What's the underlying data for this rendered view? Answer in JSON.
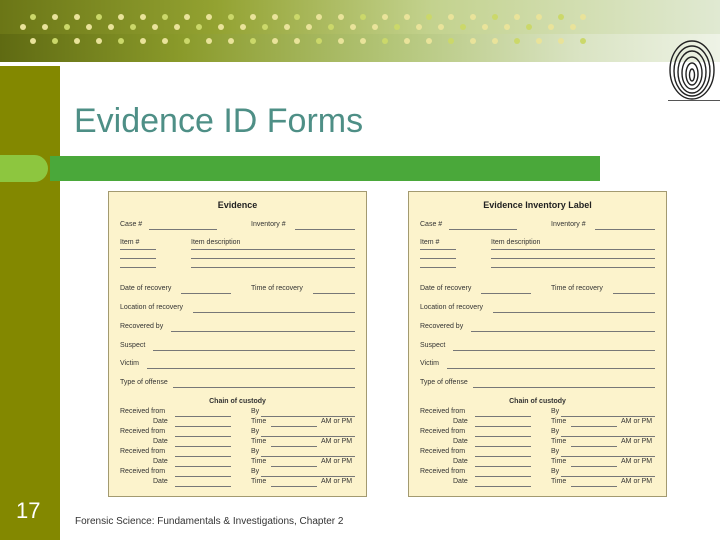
{
  "slide": {
    "title": "Evidence ID Forms",
    "page_number": "17",
    "footer": "Forensic Science: Fundamentals & Investigations, Chapter 2"
  },
  "forms": [
    {
      "title": "Evidence",
      "case_label": "Case #",
      "inventory_label": "Inventory #",
      "item_label": "Item #",
      "item_desc_label": "Item description",
      "date_recovery_label": "Date of recovery",
      "time_recovery_label": "Time of recovery",
      "location_label": "Location of recovery",
      "recovered_by_label": "Recovered by",
      "suspect_label": "Suspect",
      "victim_label": "Victim",
      "offense_label": "Type of offense",
      "chain_label": "Chain of custody",
      "received_from_label": "Received from",
      "by_label": "By",
      "date_label": "Date",
      "time_label": "Time",
      "ampm_label": "AM or PM"
    },
    {
      "title": "Evidence Inventory Label",
      "case_label": "Case #",
      "inventory_label": "Inventory #",
      "item_label": "Item #",
      "item_desc_label": "Item description",
      "date_recovery_label": "Date of recovery",
      "time_recovery_label": "Time of recovery",
      "location_label": "Location of recovery",
      "recovered_by_label": "Recovered by",
      "suspect_label": "Suspect",
      "victim_label": "Victim",
      "offense_label": "Type of offense",
      "chain_label": "Chain of custody",
      "received_from_label": "Received from",
      "by_label": "By",
      "date_label": "Date",
      "time_label": "Time",
      "ampm_label": "AM or PM"
    }
  ]
}
